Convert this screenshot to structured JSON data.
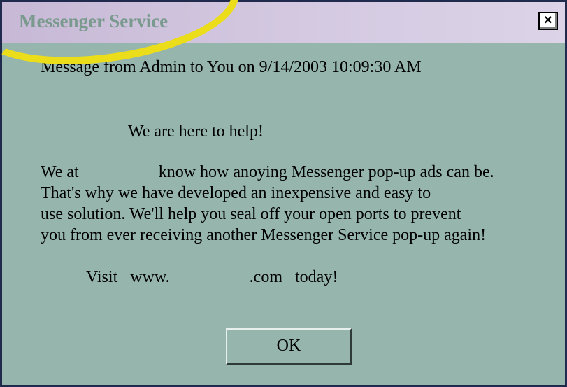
{
  "window": {
    "title": "Messenger Service",
    "close_label": "×"
  },
  "message": {
    "header": "Message from Admin to You on 9/14/2003 10:09:30 AM",
    "greeting": "We are here to help!",
    "body_lines": [
      "We at                   know how anoying Messenger pop-up ads can be.",
      "That's why we have developed an inexpensive and easy to",
      "use solution.  We'll help you seal off your open ports to prevent",
      "you from ever receiving another Messenger Service pop-up again!"
    ],
    "visit_line": "Visit   www.                   .com   today!"
  },
  "buttons": {
    "ok_label": "OK"
  },
  "colors": {
    "window_bg": "#95b5ad",
    "titlebar_bg": "#d3c8e0",
    "title_text": "#7a9a8e",
    "highlight": "#ecdd1a",
    "border": "#1f2a4d"
  }
}
